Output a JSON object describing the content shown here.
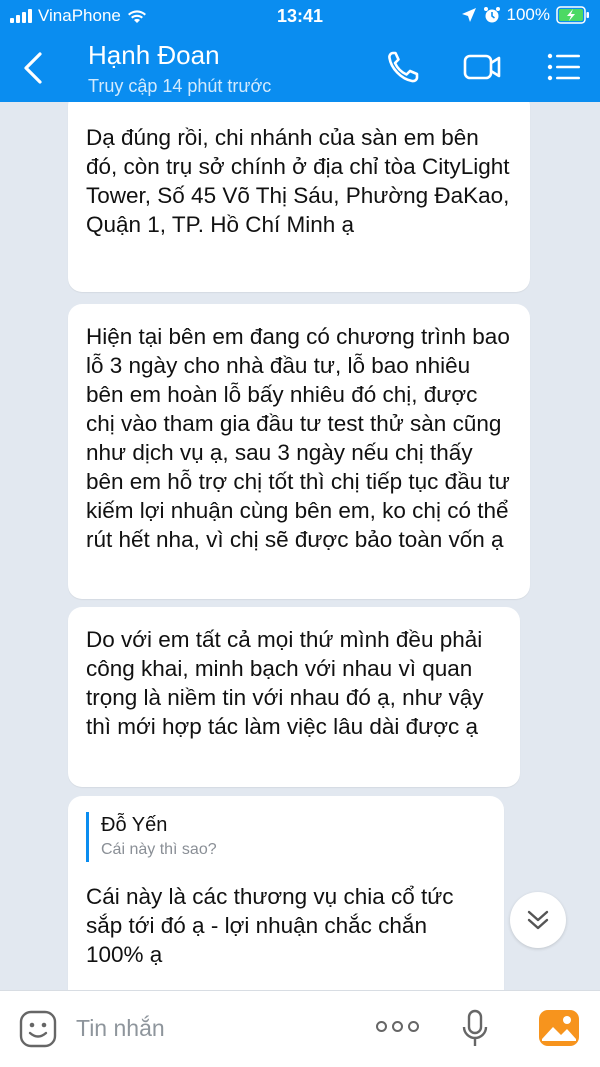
{
  "status_bar": {
    "carrier": "VinaPhone",
    "time": "13:41",
    "battery": "100%"
  },
  "header": {
    "contact_name": "Hạnh Đoan",
    "last_seen": "Truy cập 14 phút trước"
  },
  "messages": [
    {
      "text": "Dạ đúng rồi, chi nhánh của sàn em bên đó, còn trụ sở chính ở địa chỉ tòa CityLight Tower, Số 45 Võ Thị Sáu, Phường ĐaKao, Quận 1, TP. Hồ Chí Minh ạ"
    },
    {
      "text": "Hiện tại bên em đang có chương trình bao lỗ 3 ngày cho nhà đầu tư, lỗ bao nhiêu bên em hoàn lỗ bấy nhiêu đó chị, được chị vào tham gia đầu tư test thử sàn cũng như dịch vụ ạ, sau 3 ngày nếu chị thấy bên em hỗ trợ chị tốt thì chị tiếp tục đầu tư kiếm lợi nhuận cùng bên em, ko chị có thể rút hết nha, vì chị sẽ được bảo toàn vốn ạ"
    },
    {
      "text": "Do với em tất cả mọi thứ mình đều phải công khai, minh bạch với nhau vì quan trọng là niềm tin với nhau đó ạ, như vậy thì mới hợp tác làm việc lâu dài được ạ"
    },
    {
      "quote_name": "Đỗ Yến",
      "quote_text": "Cái này thì sao?",
      "text": "Cái này là các thương vụ chia cổ tức sắp tới đó ạ - lợi nhuận chắc chắn 100% ạ"
    }
  ],
  "input": {
    "placeholder": "Tin nhắn"
  },
  "colors": {
    "header_bg": "#0a8df0",
    "chat_bg": "#e2e8f0",
    "battery": "#4cd964"
  }
}
